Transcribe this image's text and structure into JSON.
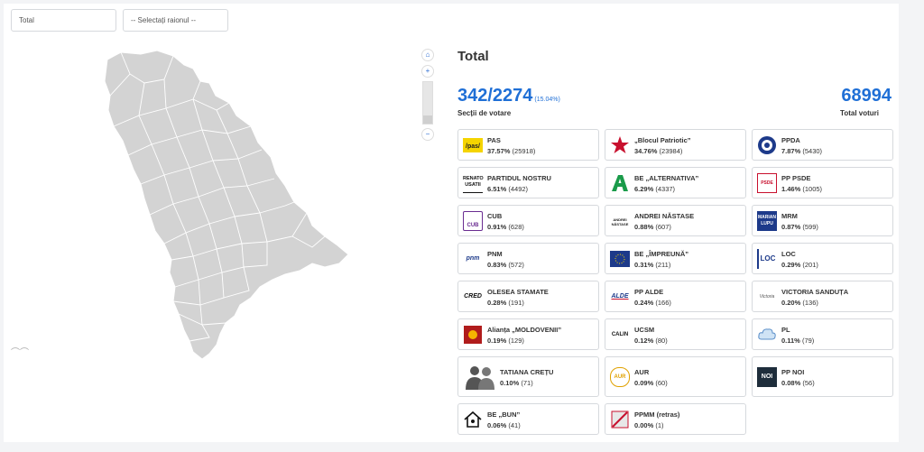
{
  "filters": {
    "scope_value": "Total",
    "district_placeholder": "-- Selectați raionul --"
  },
  "panel": {
    "title": "Total",
    "stations_counted": "342/2274",
    "stations_percent": "(15.04%)",
    "stations_label": "Secții de votare",
    "total_votes": "68994",
    "total_votes_label": "Total voturi"
  },
  "colors": {
    "accent": "#1f6fd6",
    "map_fill": "#d3d3d3",
    "map_stroke": "#ffffff"
  },
  "candidates": [
    {
      "name": "PAS",
      "percent": "37.57%",
      "votes": "(25918)",
      "logo": "pas-logo"
    },
    {
      "name": "„Blocul Patriotic”",
      "percent": "34.76%",
      "votes": "(23984)",
      "logo": "red-star-logo"
    },
    {
      "name": "PPDA",
      "percent": "7.87%",
      "votes": "(5430)",
      "logo": "ppda-seal-logo"
    },
    {
      "name": "PARTIDUL NOSTRU",
      "percent": "6.51%",
      "votes": "(4492)",
      "logo": "renato-usatii-logo",
      "logo_text": "RENATO USATII"
    },
    {
      "name": "BE „ALTERNATIVA”",
      "percent": "6.29%",
      "votes": "(4337)",
      "logo": "alternativa-logo"
    },
    {
      "name": "PP PSDE",
      "percent": "1.46%",
      "votes": "(1005)",
      "logo": "psde-logo",
      "logo_text": "PSDE"
    },
    {
      "name": "CUB",
      "percent": "0.91%",
      "votes": "(628)",
      "logo": "cub-logo",
      "logo_text": "CUB"
    },
    {
      "name": "ANDREI NĂSTASE",
      "percent": "0.88%",
      "votes": "(607)",
      "logo": "andrei-nastase-logo",
      "logo_text": "ANDREI NĂSTASE"
    },
    {
      "name": "MRM",
      "percent": "0.87%",
      "votes": "(599)",
      "logo": "marian-lupu-logo",
      "logo_text": "MARIAN LUPU"
    },
    {
      "name": "PNM",
      "percent": "0.83%",
      "votes": "(572)",
      "logo": "pnm-logo",
      "logo_text": "pnm"
    },
    {
      "name": "BE „ÎMPREUNĂ”",
      "percent": "0.31%",
      "votes": "(211)",
      "logo": "impreuna-eu-logo"
    },
    {
      "name": "LOC",
      "percent": "0.29%",
      "votes": "(201)",
      "logo": "loc-logo",
      "logo_text": "LOC"
    },
    {
      "name": "OLESEA STAMATE",
      "percent": "0.28%",
      "votes": "(191)",
      "logo": "cred-logo",
      "logo_text": "CRED"
    },
    {
      "name": "PP ALDE",
      "percent": "0.24%",
      "votes": "(166)",
      "logo": "alde-logo",
      "logo_text": "ALDE"
    },
    {
      "name": "VICTORIA SANDUȚA",
      "percent": "0.20%",
      "votes": "(136)",
      "logo": "victoria-sanduta-logo",
      "logo_text": "Victoria"
    },
    {
      "name": "Alianța „MOLDOVENII”",
      "percent": "0.19%",
      "votes": "(129)",
      "logo": "moldovenii-logo"
    },
    {
      "name": "UCSM",
      "percent": "0.12%",
      "votes": "(80)",
      "logo": "calin-logo",
      "logo_text": "CALIN"
    },
    {
      "name": "PL",
      "percent": "0.11%",
      "votes": "(79)",
      "logo": "pl-cloud-logo"
    },
    {
      "name": "TATIANA CREȚU",
      "percent": "0.10%",
      "votes": "(71)",
      "logo": "people-silhouette-logo"
    },
    {
      "name": "AUR",
      "percent": "0.09%",
      "votes": "(60)",
      "logo": "aur-logo",
      "logo_text": "AUR"
    },
    {
      "name": "PP NOI",
      "percent": "0.08%",
      "votes": "(56)",
      "logo": "noi-logo",
      "logo_text": "NOI"
    },
    {
      "name": "BE „BUN”",
      "percent": "0.06%",
      "votes": "(41)",
      "logo": "house-logo"
    },
    {
      "name": "PPMM (retras)",
      "percent": "0.00%",
      "votes": "(1)",
      "logo": "ppmm-logo"
    }
  ]
}
